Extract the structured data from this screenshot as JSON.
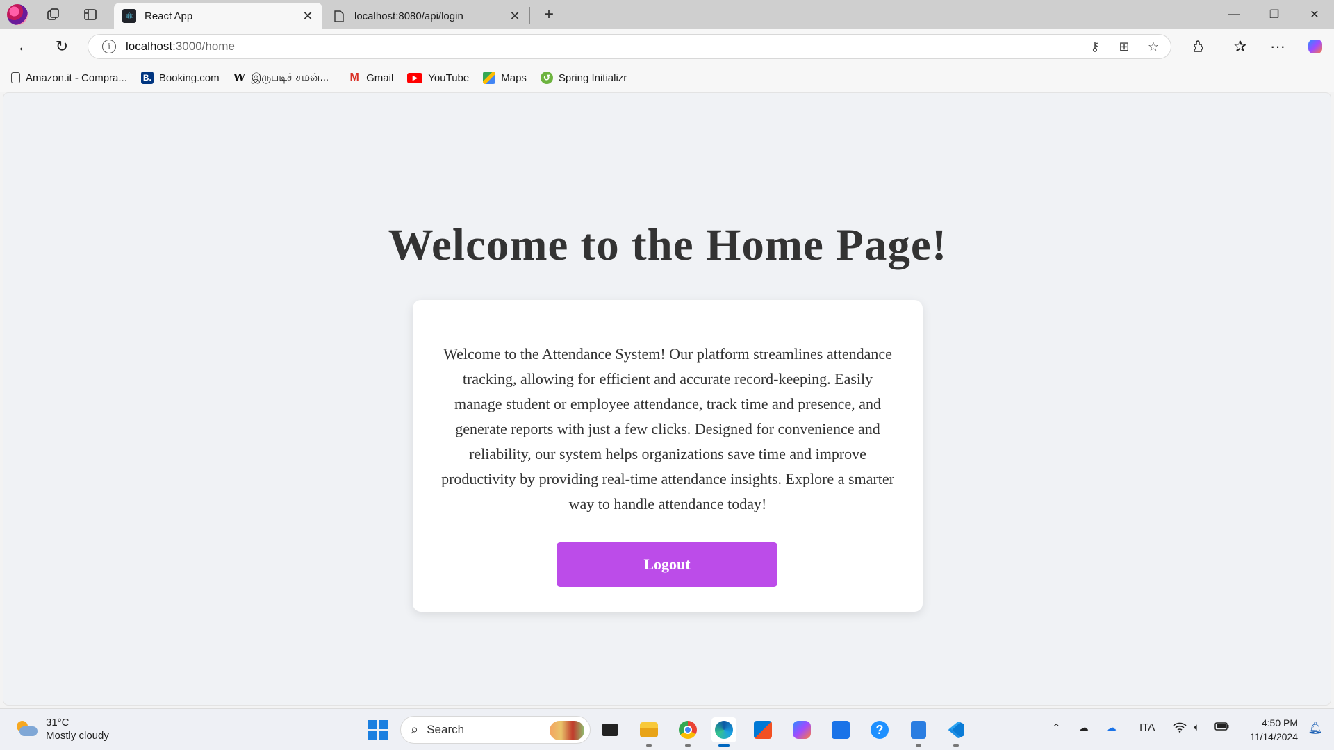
{
  "tabs": [
    {
      "title": "React App",
      "active": true
    },
    {
      "title": "localhost:8080/api/login",
      "active": false
    }
  ],
  "window_controls": {
    "minimize": "—",
    "restore": "❐",
    "close": "✕"
  },
  "address_bar": {
    "host": "localhost",
    "path": ":3000/home"
  },
  "favorites": [
    {
      "label": "Amazon.it - Compra...",
      "icon": "page-icon"
    },
    {
      "label": "Booking.com",
      "icon": "booking-icon",
      "glyph": "B."
    },
    {
      "label": "இருபடிச் சமன்...",
      "icon": "wikipedia-icon",
      "glyph": "W"
    },
    {
      "label": "Gmail",
      "icon": "gmail-icon",
      "glyph": "M"
    },
    {
      "label": "YouTube",
      "icon": "youtube-icon",
      "glyph": "▶"
    },
    {
      "label": "Maps",
      "icon": "maps-icon"
    },
    {
      "label": "Spring Initializr",
      "icon": "spring-icon",
      "glyph": "↺"
    }
  ],
  "page": {
    "heading": "Welcome to the Home Page!",
    "description": "Welcome to the Attendance System! Our platform streamlines attendance tracking, allowing for efficient and accurate record-keeping. Easily manage student or employee attendance, track time and presence, and generate reports with just a few clicks. Designed for convenience and reliability, our system helps organizations save time and improve productivity by providing real-time attendance insights. Explore a smarter way to handle attendance today!",
    "logout_label": "Logout"
  },
  "colors": {
    "logout_button": "#bc4ce9",
    "page_background": "#f0f2f5",
    "heading_text": "#333333"
  },
  "taskbar": {
    "weather_temp": "31°C",
    "weather_desc": "Mostly cloudy",
    "search_placeholder": "Search",
    "language": "ITA",
    "time": "4:50 PM",
    "date": "11/14/2024"
  }
}
